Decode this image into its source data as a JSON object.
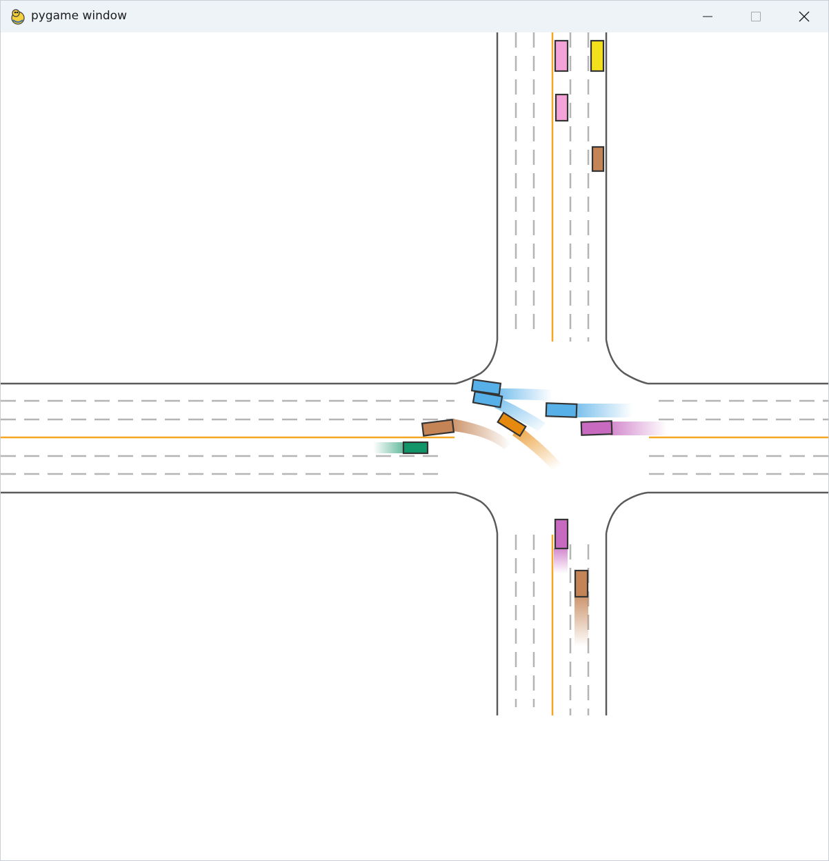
{
  "window": {
    "title": "pygame window",
    "icon": "pygame-snake-icon",
    "controls": [
      "minimize-icon",
      "maximize-icon",
      "close-icon"
    ]
  },
  "scene": {
    "type": "traffic intersection simulation",
    "lane_line_color": "#b4b4b4",
    "road_edge_color": "#5a5a5a",
    "center_line_color": "#f5a623",
    "vehicles": [
      {
        "id": "pink-1",
        "color": "#f4a3d8",
        "heading": "north"
      },
      {
        "id": "yellow-1",
        "color": "#f2e01d",
        "heading": "south"
      },
      {
        "id": "pink-2",
        "color": "#f4a3d8",
        "heading": "north"
      },
      {
        "id": "brown-1",
        "color": "#c48455",
        "heading": "south"
      },
      {
        "id": "blue-1",
        "color": "#58b0e8",
        "heading": "west"
      },
      {
        "id": "blue-2",
        "color": "#58b0e8",
        "heading": "west"
      },
      {
        "id": "blue-3",
        "color": "#58b0e8",
        "heading": "west"
      },
      {
        "id": "orange-1",
        "color": "#e68a0f",
        "heading": "turning"
      },
      {
        "id": "brown-2",
        "color": "#c48455",
        "heading": "turning"
      },
      {
        "id": "magenta-1",
        "color": "#c86bc0",
        "heading": "west"
      },
      {
        "id": "green-1",
        "color": "#129568",
        "heading": "east"
      },
      {
        "id": "magenta-2",
        "color": "#c86bc0",
        "heading": "north"
      },
      {
        "id": "brown-3",
        "color": "#c48455",
        "heading": "north"
      }
    ]
  }
}
